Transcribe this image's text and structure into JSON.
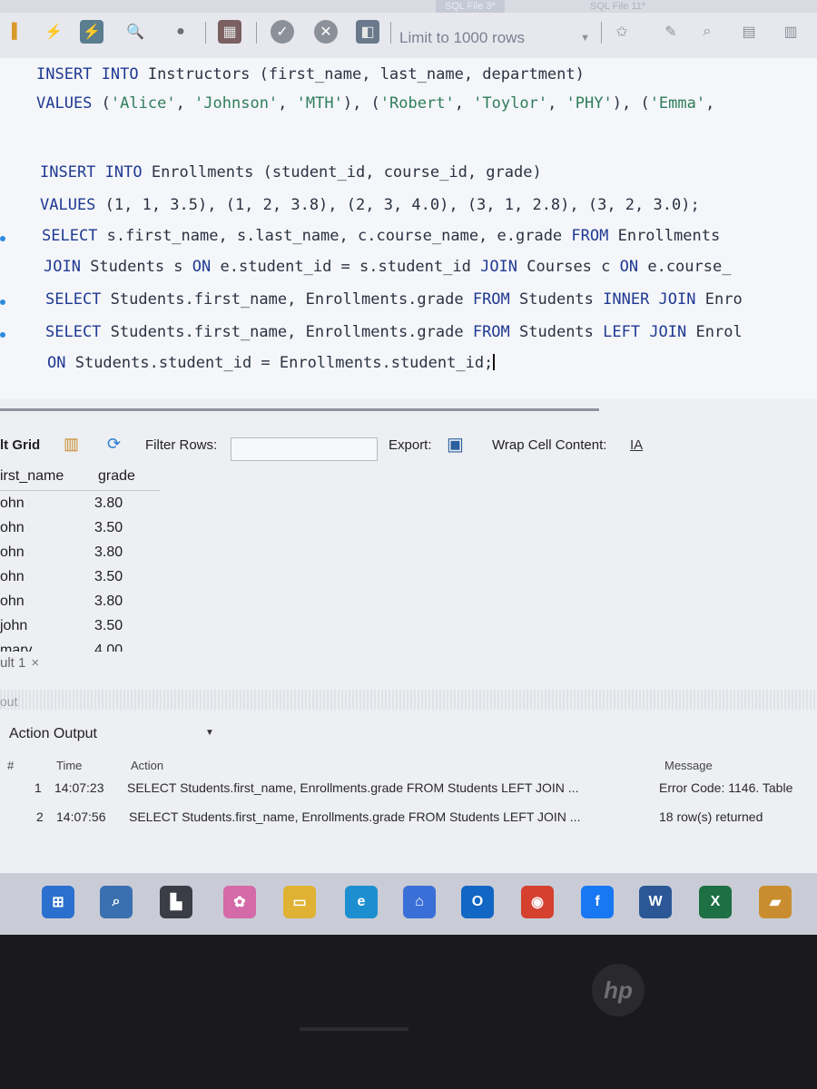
{
  "tabs": [
    {
      "label": "SQL File 3*"
    },
    {
      "label": "SQL File 11*"
    }
  ],
  "toolbar": {
    "icons": [
      "lightning-icon",
      "lightning-cursor-icon",
      "search-icon",
      "stop-icon",
      "toggle-icon",
      "commit-icon",
      "rollback-icon",
      "autocommit-icon",
      "star-icon",
      "brush-icon",
      "find-icon",
      "indent-icon",
      "wrap-icon"
    ],
    "limit_label": "Limit to 1000 rows"
  },
  "editor": {
    "lines": [
      {
        "k1": "INSERT INTO",
        "t1": " Instructors (first_name, last_name, department)"
      },
      {
        "k1": "VALUES",
        "t1": " (",
        "s1": "'Alice'",
        "t2": ", ",
        "s2": "'Johnson'",
        "t3": ", ",
        "s3": "'MTH'",
        "t4": "), (",
        "s4": "'Robert'",
        "t5": ", ",
        "s5": "'Toylor'",
        "t6": ", ",
        "s6": "'PHY'",
        "t7": "), (",
        "s7": "'Emma'",
        "t8": ","
      },
      {
        "k1": "INSERT INTO",
        "t1": " Enrollments (student_id, course_id, grade)"
      },
      {
        "k1": "VALUES",
        "t1": " (1, 1, 3.5), (1, 2, 3.8), (2, 3, 4.0), (3, 1, 2.8), (3, 2, 3.0);"
      },
      {
        "k1": "SELECT",
        "t1": " s.first_name, s.last_name, c.course_name, e.grade ",
        "k2": "FROM",
        "t2": " Enrollments"
      },
      {
        "k1": "JOIN",
        "t1": " Students s ",
        "k2": "ON",
        "t2": " e.student_id = s.student_id ",
        "k3": "JOIN",
        "t3": " Courses c ",
        "k4": "ON",
        "t4": " e.course_"
      },
      {
        "k1": "SELECT",
        "t1": " Students.first_name, Enrollments.grade ",
        "k2": "FROM",
        "t2": " Students ",
        "k3": "INNER JOIN",
        "t3": " Enro"
      },
      {
        "k1": "SELECT",
        "t1": " Students.first_name, Enrollments.grade ",
        "k2": "FROM",
        "t2": " Students ",
        "k3": "LEFT JOIN",
        "t3": " Enrol"
      },
      {
        "k1": "ON",
        "t1": " Students.student_id = Enrollments.student_id;"
      }
    ]
  },
  "result_toolbar": {
    "grid_label": "lt Grid",
    "filter_label": "Filter Rows:",
    "filter_value": "",
    "export_label": "Export:",
    "wrap_label": "Wrap Cell Content:",
    "wrap_icon_text": "IA"
  },
  "grid": {
    "columns": [
      "irst_name",
      "grade"
    ],
    "rows": [
      [
        "ohn",
        "3.80"
      ],
      [
        "ohn",
        "3.50"
      ],
      [
        "ohn",
        "3.80"
      ],
      [
        "ohn",
        "3.50"
      ],
      [
        "ohn",
        "3.80"
      ],
      [
        "john",
        "3.50"
      ],
      [
        "marv",
        "4.00"
      ]
    ]
  },
  "result_tab": {
    "label": "ult 1",
    "close": "×"
  },
  "output_section_label": "out",
  "output": {
    "selector_label": "Action Output",
    "headers": {
      "num": "#",
      "time": "Time",
      "action": "Action",
      "message": "Message"
    },
    "rows": [
      {
        "num": "1",
        "time": "14:07:23",
        "action": "SELECT Students.first_name, Enrollments.grade FROM Students LEFT JOIN ...",
        "message": "Error Code: 1146. Table"
      },
      {
        "num": "2",
        "time": "14:07:56",
        "action": "SELECT Students.first_name, Enrollments.grade FROM Students LEFT JOIN ...",
        "message": "18 row(s) returned"
      }
    ]
  },
  "taskbar": {
    "apps": [
      {
        "name": "start-icon",
        "color": "#2b6fcf",
        "glyph": "⊞"
      },
      {
        "name": "search-icon",
        "color": "#3a6fb0",
        "glyph": "⌕"
      },
      {
        "name": "task-view-icon",
        "color": "#3a3d45",
        "glyph": "▙"
      },
      {
        "name": "copilot-icon",
        "color": "#d56aa8",
        "glyph": "✿"
      },
      {
        "name": "file-explorer-icon",
        "color": "#e0b233",
        "glyph": "▭"
      },
      {
        "name": "edge-icon",
        "color": "#1d8fd0",
        "glyph": "e"
      },
      {
        "name": "store-icon",
        "color": "#3b6fd8",
        "glyph": "⌂"
      },
      {
        "name": "outlook-icon",
        "color": "#1266c4",
        "glyph": "O"
      },
      {
        "name": "chrome-icon",
        "color": "#d6402f",
        "glyph": "◉"
      },
      {
        "name": "facebook-icon",
        "color": "#1877f2",
        "glyph": "f"
      },
      {
        "name": "word-icon",
        "color": "#2b5797",
        "glyph": "W"
      },
      {
        "name": "excel-icon",
        "color": "#1d7044",
        "glyph": "X"
      },
      {
        "name": "folder-icon",
        "color": "#c98d2f",
        "glyph": "▰"
      }
    ]
  },
  "bezel": {
    "logo": "hp"
  }
}
